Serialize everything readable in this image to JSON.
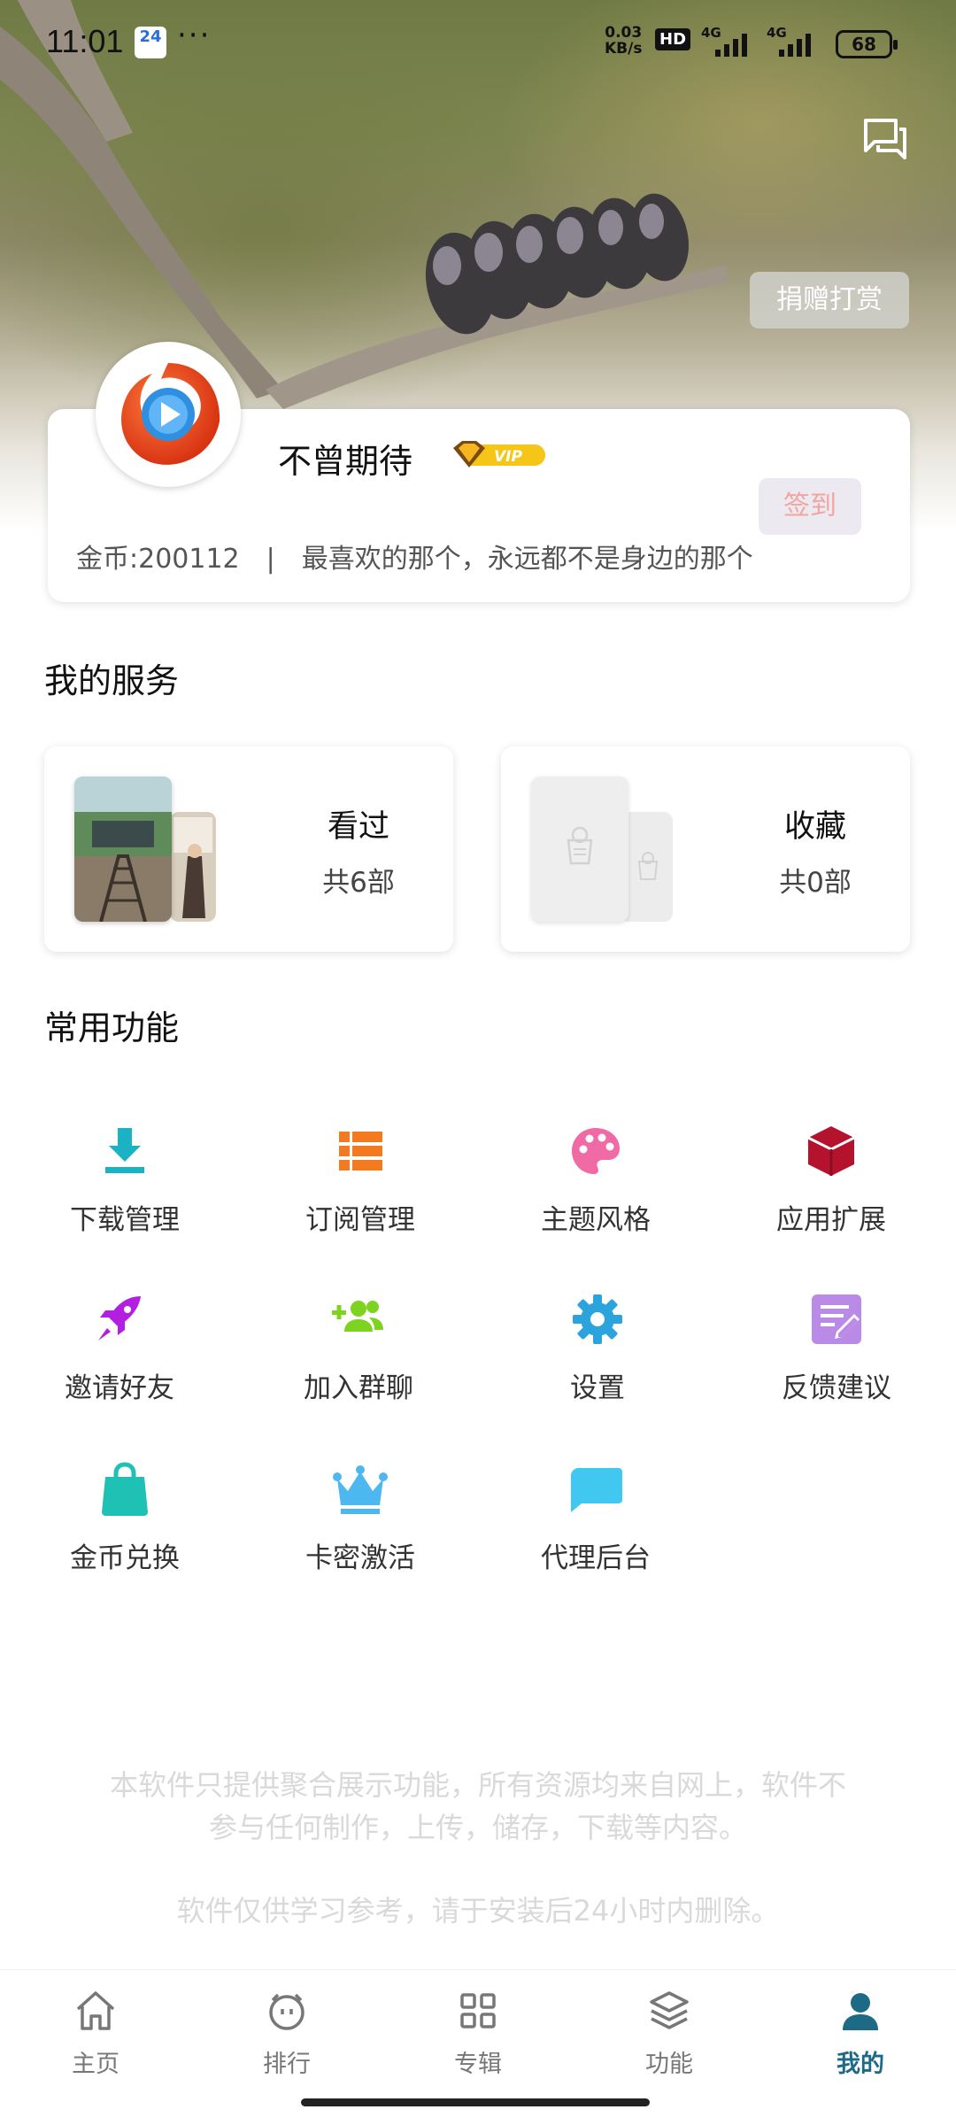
{
  "status_bar": {
    "time": "11:01",
    "calendar_badge": "24",
    "more": "···",
    "net_speed_value": "0.03",
    "net_speed_unit": "KB/s",
    "hd_label": "HD",
    "signal_1": "4G",
    "signal_2": "4G",
    "battery": "68"
  },
  "header": {
    "donate_label": "捐赠打赏",
    "message_icon": "chat-bubbles-icon"
  },
  "profile": {
    "username": "不曾期待",
    "vip_label": "VIP",
    "checkin_label": "签到",
    "coins": "金币:200112",
    "separator": "|",
    "signature": "最喜欢的那个，永远都不是身边的那个"
  },
  "services": {
    "title": "我的服务",
    "items": [
      {
        "label": "看过",
        "count": "共6部"
      },
      {
        "label": "收藏",
        "count": "共0部"
      }
    ]
  },
  "functions": {
    "title": "常用功能",
    "items": [
      {
        "label": "下载管理",
        "icon": "download-icon",
        "color": "#1bb3c4"
      },
      {
        "label": "订阅管理",
        "icon": "list-icon",
        "color": "#f47a1f"
      },
      {
        "label": "主题风格",
        "icon": "palette-icon",
        "color": "#f06aa5"
      },
      {
        "label": "应用扩展",
        "icon": "cube-icon",
        "color": "#b5122e"
      },
      {
        "label": "邀请好友",
        "icon": "rocket-icon",
        "color": "#b31fe0"
      },
      {
        "label": "加入群聊",
        "icon": "group-add-icon",
        "color": "#7ed321"
      },
      {
        "label": "设置",
        "icon": "gear-icon",
        "color": "#2ba3dc"
      },
      {
        "label": "反馈建议",
        "icon": "feedback-icon",
        "color": "#b98ae6"
      },
      {
        "label": "金币兑换",
        "icon": "bag-icon",
        "color": "#1fc1b4"
      },
      {
        "label": "卡密激活",
        "icon": "crown-icon",
        "color": "#4db8ef"
      },
      {
        "label": "代理后台",
        "icon": "chat-box-icon",
        "color": "#40c8f0"
      }
    ]
  },
  "disclaimer": {
    "line1": "本软件只提供聚合展示功能，所有资源均来自网上，软件不",
    "line2": "参与任何制作，上传，储存，下载等内容。",
    "line3": "软件仅供学习参考，请于安装后24小时内删除。"
  },
  "bottom_nav": {
    "items": [
      {
        "label": "主页",
        "icon": "home-icon"
      },
      {
        "label": "排行",
        "icon": "ranking-icon"
      },
      {
        "label": "专辑",
        "icon": "grid-icon"
      },
      {
        "label": "功能",
        "icon": "layers-icon"
      },
      {
        "label": "我的",
        "icon": "person-icon",
        "active": true
      }
    ],
    "active_color": "#1d6a86"
  }
}
